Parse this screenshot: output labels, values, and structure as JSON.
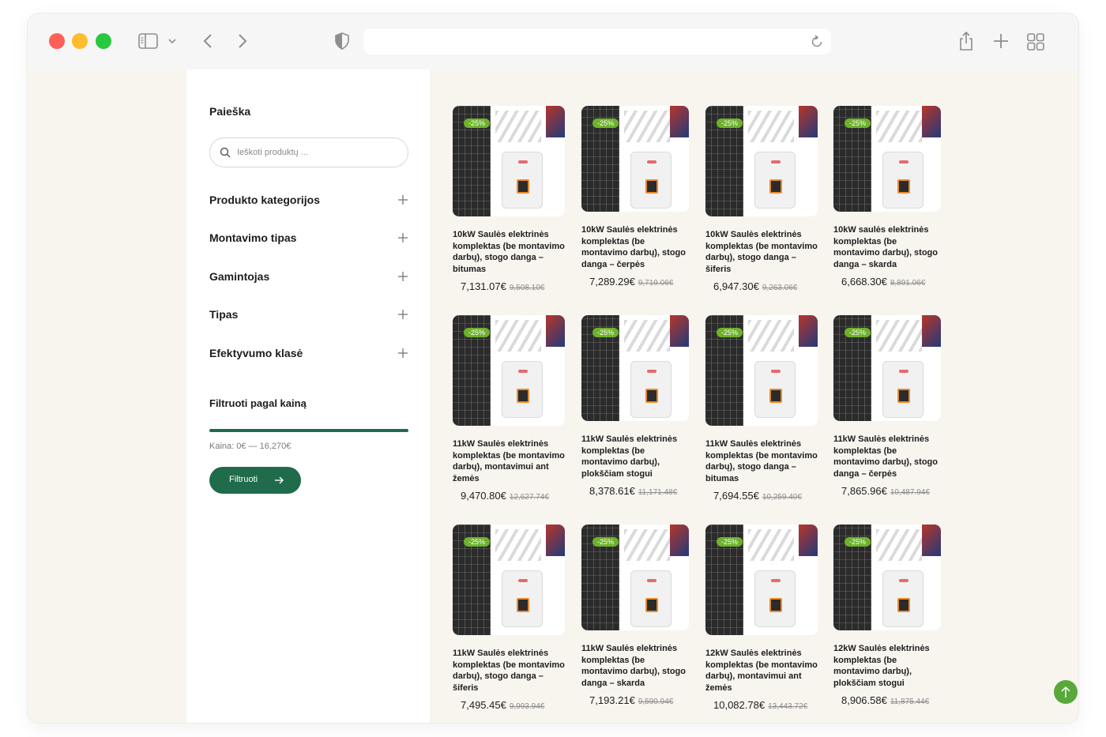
{
  "browser": {
    "address_value": "",
    "icons": [
      "sidebar-icon",
      "chevron-down-icon",
      "back-icon",
      "forward-icon",
      "shield-icon",
      "reload-icon",
      "share-icon",
      "new-tab-icon",
      "tab-overview-icon"
    ]
  },
  "sidebar": {
    "search_title": "Paieška",
    "search_placeholder": "Ieškoti produktų ...",
    "accordion": [
      {
        "label": "Produkto kategorijos"
      },
      {
        "label": "Montavimo tipas"
      },
      {
        "label": "Gamintojas"
      },
      {
        "label": "Tipas"
      },
      {
        "label": "Efektyvumo klasė"
      }
    ],
    "price_filter_title": "Filtruoti pagal kainą",
    "price_range": "Kaina: 0€ — 16,270€",
    "filter_button": "Filtruoti",
    "accent_color": "#1f6b4b"
  },
  "products": [
    {
      "badge": "-25%",
      "title": "10kW Saulės elektrinės komplektas (be montavimo darbų), stogo danga – bitumas",
      "price": "7,131.07€",
      "old_price": "9,508.10€"
    },
    {
      "badge": "-25%",
      "title": "10kW Saulės elektrinės komplektas (be montavimo darbų), stogo danga – čerpės",
      "price": "7,289.29€",
      "old_price": "9,719.06€"
    },
    {
      "badge": "-25%",
      "title": "10kW Saulės elektrinės komplektas (be montavimo darbų), stogo danga – šiferis",
      "price": "6,947.30€",
      "old_price": "9,263.06€"
    },
    {
      "badge": "-25%",
      "title": "10kW saulės elektrinės komplektas (be montavimo darbų), stogo danga – skarda",
      "price": "6,668.30€",
      "old_price": "8,891.06€"
    },
    {
      "badge": "-25%",
      "title": "11kW Saulės elektrinės komplektas (be montavimo darbų), montavimui ant žemės",
      "price": "9,470.80€",
      "old_price": "12,627.74€"
    },
    {
      "badge": "-25%",
      "title": "11kW Saulės elektrinės komplektas (be montavimo darbų), plokščiam stogui",
      "price": "8,378.61€",
      "old_price": "11,171.48€"
    },
    {
      "badge": "-25%",
      "title": "11kW Saulės elektrinės komplektas (be montavimo darbų), stogo danga – bitumas",
      "price": "7,694.55€",
      "old_price": "10,259.40€"
    },
    {
      "badge": "-25%",
      "title": "11kW Saulės elektrinės komplektas (be montavimo darbų), stogo danga – čerpės",
      "price": "7,865.96€",
      "old_price": "10,487.94€"
    },
    {
      "badge": "-25%",
      "title": "11kW Saulės elektrinės komplektas (be montavimo darbų), stogo danga – šiferis",
      "price": "7,495.45€",
      "old_price": "9,993.94€"
    },
    {
      "badge": "-25%",
      "title": "11kW Saulės elektrinės komplektas (be montavimo darbų), stogo danga – skarda",
      "price": "7,193.21€",
      "old_price": "9,590.94€"
    },
    {
      "badge": "-25%",
      "title": "12kW Saulės elektrinės komplektas (be montavimo darbų), montavimui ant žemės",
      "price": "10,082.78€",
      "old_price": "13,443.72€"
    },
    {
      "badge": "-25%",
      "title": "12kW Saulės elektrinės komplektas (be montavimo darbų), plokščiam stogui",
      "price": "8,906.58€",
      "old_price": "11,875.44€"
    }
  ],
  "colors": {
    "badge": "#6db22b",
    "page_bg": "#f8f5ef",
    "scroll_top": "#58a83b"
  }
}
